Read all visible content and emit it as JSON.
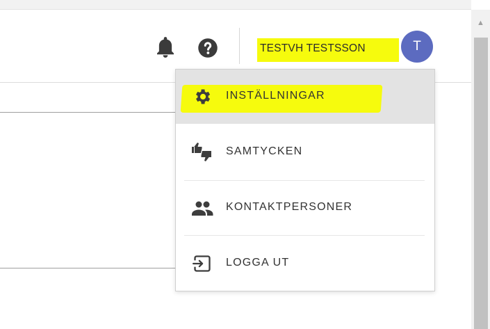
{
  "header": {
    "icons": {
      "notifications": "bell-icon",
      "help": "help-circle-icon"
    },
    "user_name": "TESTVH TESTSSON",
    "avatar_initial": "T",
    "avatar_color": "#5c6bc0",
    "highlight_color": "#f6fb0d"
  },
  "menu": {
    "items": [
      {
        "label": "INSTÄLLNINGAR",
        "icon": "gear-icon"
      },
      {
        "label": "SAMTYCKEN",
        "icon": "thumbs-up-down-icon"
      },
      {
        "label": "KONTAKTPERSONER",
        "icon": "people-icon"
      },
      {
        "label": "LOGGA UT",
        "icon": "logout-icon"
      }
    ]
  }
}
